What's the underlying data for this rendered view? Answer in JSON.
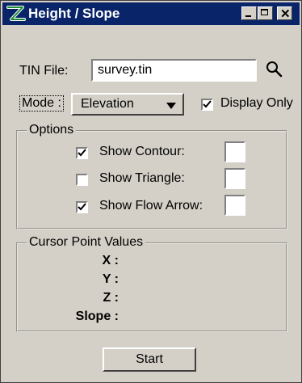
{
  "window": {
    "title": "Height / Slope"
  },
  "tin": {
    "label": "TIN File:",
    "value": "survey.tin"
  },
  "mode": {
    "label": "Mode :",
    "selected": "Elevation"
  },
  "display_only": {
    "label": "Display Only",
    "checked": true
  },
  "options": {
    "legend": "Options",
    "items": [
      {
        "label": "Show Contour:",
        "checked": true
      },
      {
        "label": "Show Triangle:",
        "checked": false
      },
      {
        "label": "Show Flow Arrow:",
        "checked": true
      }
    ]
  },
  "cursor": {
    "legend": "Cursor Point Values",
    "labels": [
      "X :",
      "Y :",
      "Z :",
      "Slope :"
    ]
  },
  "start_button": {
    "label": "Start"
  },
  "colors": {
    "titlebar": "#0a246a",
    "face": "#d4d0c8",
    "icon_green": "#1e8a3a"
  }
}
